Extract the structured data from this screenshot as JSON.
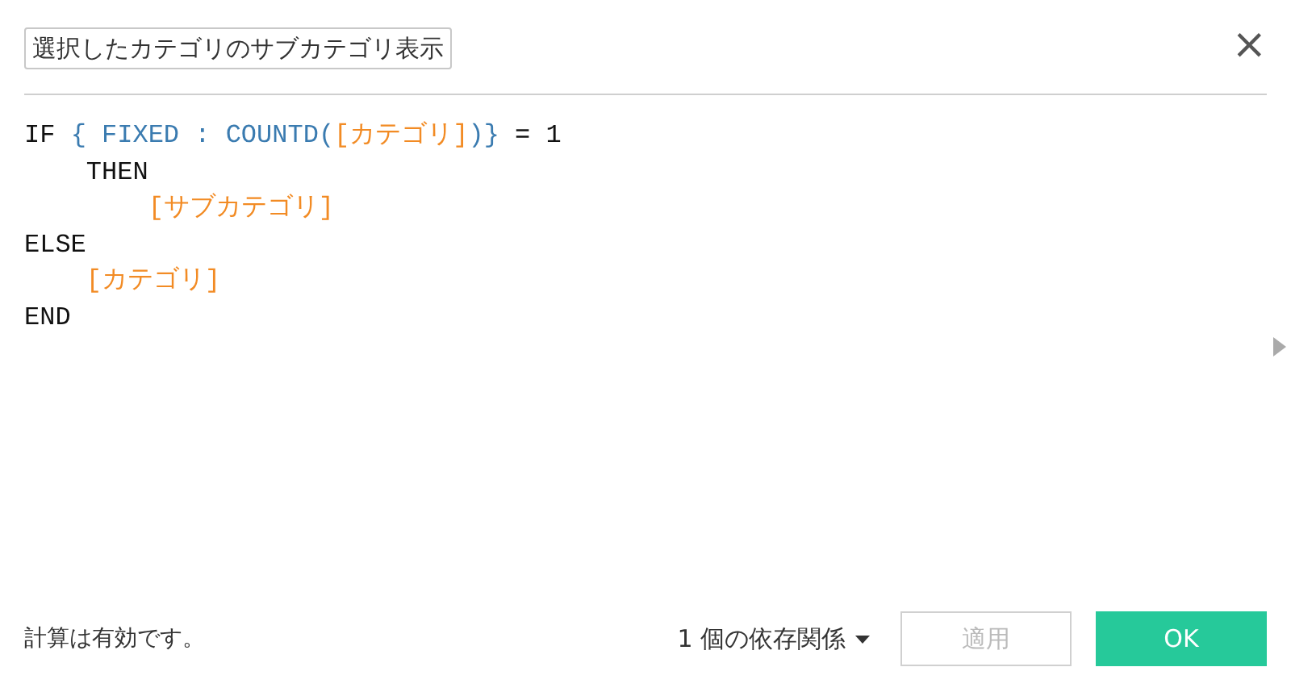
{
  "dialog": {
    "name_field": {
      "value": "選択したカテゴリのサブカテゴリ表示"
    },
    "close_button": {
      "label": "×"
    }
  },
  "formula": {
    "lines": [
      {
        "tokens": [
          {
            "kind": "keyword",
            "text": "IF "
          },
          {
            "kind": "function",
            "text": "{ FIXED : COUNTD("
          },
          {
            "kind": "field",
            "text": "[カテゴリ]"
          },
          {
            "kind": "function",
            "text": ")}"
          },
          {
            "kind": "keyword",
            "text": " = 1"
          }
        ]
      },
      {
        "tokens": [
          {
            "kind": "keyword",
            "text": "    THEN"
          }
        ]
      },
      {
        "tokens": [
          {
            "kind": "field",
            "text": "        [サブカテゴリ]"
          }
        ]
      },
      {
        "tokens": [
          {
            "kind": "keyword",
            "text": "ELSE"
          }
        ]
      },
      {
        "tokens": [
          {
            "kind": "field",
            "text": "    [カテゴリ]"
          }
        ]
      },
      {
        "tokens": [
          {
            "kind": "keyword",
            "text": "END"
          }
        ]
      }
    ]
  },
  "footer": {
    "status": "計算は有効です。",
    "dependencies": "1 個の依存関係",
    "buttons": [
      {
        "label": "適用",
        "kind": "secondary",
        "disabled": true
      },
      {
        "label": "OK",
        "kind": "primary",
        "disabled": false
      }
    ]
  }
}
